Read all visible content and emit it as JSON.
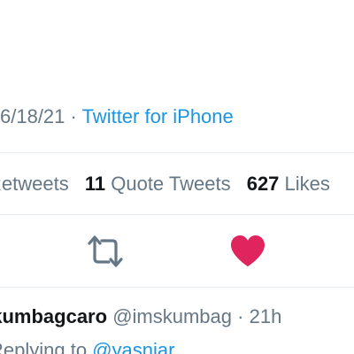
{
  "tweet": {
    "date": "6/18/21",
    "separator": "·",
    "source": "Twitter for iPhone"
  },
  "stats": {
    "retweets_label": "Retweets",
    "quote_count": "11",
    "quote_label": "Quote Tweets",
    "likes_count": "627",
    "likes_label": "Likes"
  },
  "actions": {
    "retweet_icon": "retweet-icon",
    "like_icon": "heart-icon",
    "like_color": "#e0245e",
    "retweet_color": "#657786"
  },
  "reply": {
    "display_name": "skumbagcaro",
    "handle": "@imskumbag",
    "separator": "·",
    "time": "21h",
    "context_prefix": "Replying to",
    "mention": "@yasniar"
  },
  "colors": {
    "link": "#1b95e0",
    "muted": "#657786",
    "text": "#14171a",
    "divider": "#e6ecf0"
  }
}
